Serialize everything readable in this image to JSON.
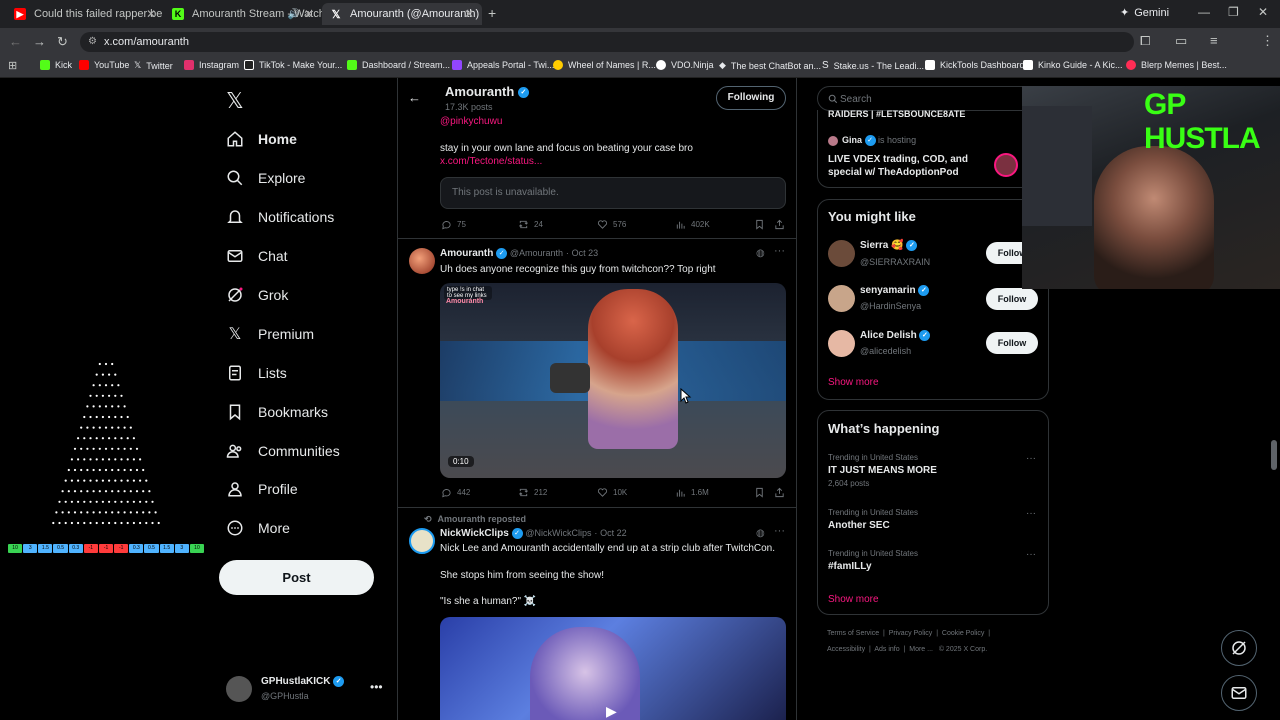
{
  "browser": {
    "tabs": [
      {
        "label": "Could this failed rapper be the"
      },
      {
        "label": "Amouranth Stream - Watch"
      },
      {
        "label": "Amouranth (@Amouranth) / X"
      }
    ],
    "gemini_label": "Gemini",
    "url": "x.com/amouranth",
    "bookmarks": [
      {
        "label": "Kick",
        "color": "#53fc18"
      },
      {
        "label": "YouTube",
        "color": "#ff0000"
      },
      {
        "label": "Twitter",
        "color": "#ffffff"
      },
      {
        "label": "Instagram",
        "color": "#e1306c"
      },
      {
        "label": "TikTok - Make Your...",
        "color": "#ffffff"
      },
      {
        "label": "Dashboard / Stream...",
        "color": "#53fc18"
      },
      {
        "label": "Appeals Portal - Twi...",
        "color": "#9146ff"
      },
      {
        "label": "Wheel of Names | R...",
        "color": "#ffcc00"
      },
      {
        "label": "VDO.Ninja",
        "color": "#ffffff"
      },
      {
        "label": "The best ChatBot an...",
        "color": "#ffffff"
      },
      {
        "label": "Stake.us - The Leadi...",
        "color": "#ffffff"
      },
      {
        "label": "KickTools Dashboard",
        "color": "#ffffff"
      },
      {
        "label": "Kinko Guide - A Kic...",
        "color": "#ffffff"
      },
      {
        "label": "Blerp Memes | Best...",
        "color": "#ff2d55"
      }
    ]
  },
  "sidebar": {
    "items": [
      {
        "label": "Home",
        "icon": "home-icon"
      },
      {
        "label": "Explore",
        "icon": "search-icon"
      },
      {
        "label": "Notifications",
        "icon": "bell-icon"
      },
      {
        "label": "Chat",
        "icon": "mail-icon"
      },
      {
        "label": "Grok",
        "icon": "grok-icon"
      },
      {
        "label": "Premium",
        "icon": "x-icon"
      },
      {
        "label": "Lists",
        "icon": "list-icon"
      },
      {
        "label": "Bookmarks",
        "icon": "bookmark-icon"
      },
      {
        "label": "Communities",
        "icon": "people-icon"
      },
      {
        "label": "Profile",
        "icon": "person-icon"
      },
      {
        "label": "More",
        "icon": "more-circle-icon"
      }
    ],
    "post_label": "Post",
    "account": {
      "name": "GPHustlaKICK",
      "handle": "@GPHustla"
    }
  },
  "plinko_values": [
    "10",
    "3",
    "1.5",
    "0.5",
    "0.3",
    "-1",
    "-1",
    "-1",
    "0.3",
    "0.5",
    "1.5",
    "3",
    "10"
  ],
  "profile_header": {
    "name": "Amouranth",
    "posts": "17.3K posts",
    "following_label": "Following"
  },
  "posts": [
    {
      "mention": "@pinkychuwu",
      "text": "stay in your own lane and focus on beating your case bro",
      "link": "x.com/Tectone/status...",
      "unavailable": "This post is unavailable.",
      "replies": "75",
      "reposts": "24",
      "likes": "576",
      "views": "402K"
    },
    {
      "name": "Amouranth",
      "handle": "@Amouranth",
      "date": "Oct 23",
      "text": "Uh does anyone recognize this guy from twitchcon?? Top right",
      "video_caption": "type !s in chat to see my links",
      "video_tag": "Amouranth",
      "duration": "0:10",
      "replies": "442",
      "reposts": "212",
      "likes": "10K",
      "views": "1.6M"
    },
    {
      "repost_label": "Amouranth reposted",
      "name": "NickWickClips",
      "handle": "@NickWickClips",
      "date": "Oct 22",
      "text1": "Nick Lee and Amouranth accidentally end up at a strip club after TwitchCon.",
      "text2": "She stops him from seeing the show!",
      "text3": "\"Is she a human?\" ☠️"
    }
  ],
  "right": {
    "search_placeholder": "Search",
    "top_partial": "RAIDERS | #LETSBOUNCE8ATE",
    "live": {
      "name": "Gina",
      "hosting": "is hosting",
      "title": "LIVE VDEX trading, COD, and special w/ TheAdoptionPod"
    },
    "you_might_like": {
      "title": "You might like",
      "users": [
        {
          "name": "Sierra 🥰",
          "handle": "@SIERRAXRAIN",
          "follow": "Follow"
        },
        {
          "name": "senyamarin",
          "handle": "@HardinSenya",
          "follow": "Follow"
        },
        {
          "name": "Alice Delish",
          "handle": "@alicedelish",
          "follow": "Follow"
        }
      ],
      "show_more": "Show more"
    },
    "happening": {
      "title": "What’s happening",
      "trends": [
        {
          "meta": "Trending in United States",
          "name": "IT JUST MEANS MORE",
          "count": "2,604 posts"
        },
        {
          "meta": "Trending in United States",
          "name": "Another SEC",
          "count": ""
        },
        {
          "meta": "Trending in United States",
          "name": "#famILLy",
          "count": ""
        }
      ],
      "show_more": "Show more"
    },
    "footer": {
      "line1": [
        "Terms of Service",
        "Privacy Policy",
        "Cookie Policy"
      ],
      "line2": [
        "Accessibility",
        "Ads info",
        "More ...",
        "© 2025 X Corp."
      ]
    }
  },
  "webcam": {
    "overlay_text": "GP HUSTLA"
  }
}
